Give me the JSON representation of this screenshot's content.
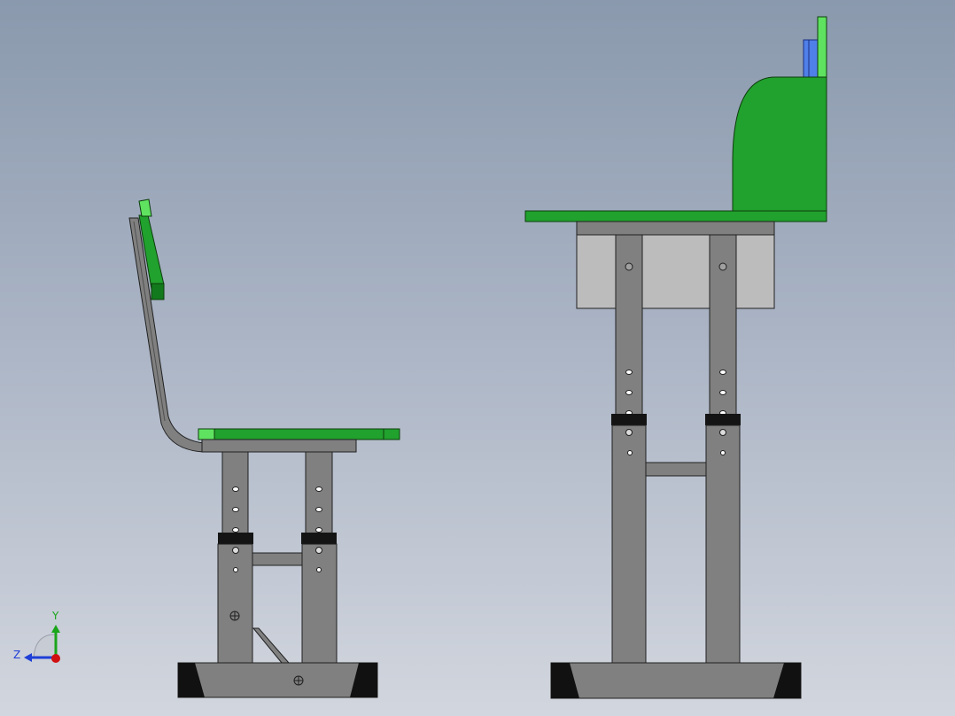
{
  "window": {
    "view": "cad-graphics-area",
    "background_top": "#8a99ad",
    "background_bottom": "#d2d6de"
  },
  "colors": {
    "seat_green": "#21a12d",
    "seat_green_light": "#5fe25f",
    "seat_green_dark": "#127a1c",
    "frame_gray": "#808080",
    "bracket_gray": "#bcbcbc",
    "collar_black": "#141414",
    "foot_black": "#111111",
    "accent_blue": "#4f7fe8"
  },
  "views": {
    "side_view": {
      "name": "chair-side-view"
    },
    "front_view": {
      "name": "chair-front-view"
    }
  },
  "triad": {
    "y_label": "Y",
    "z_label": "Z",
    "y_color": "#1aa51a",
    "z_color": "#1f3fd6",
    "origin_color": "#d01010"
  }
}
